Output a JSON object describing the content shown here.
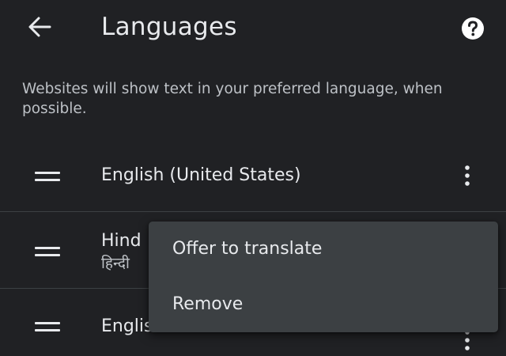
{
  "header": {
    "title": "Languages",
    "back_icon": "arrow-left-icon",
    "help_icon": "help-circle-icon"
  },
  "description": "Websites will show text in your preferred language, when possible.",
  "languages": [
    {
      "name": "English (United States)",
      "native": ""
    },
    {
      "name": "Hind",
      "native": "हिन्दी"
    },
    {
      "name": "Englis",
      "native": ""
    }
  ],
  "context_menu": {
    "items": [
      {
        "label": "Offer to translate"
      },
      {
        "label": "Remove"
      }
    ]
  },
  "colors": {
    "background": "#202124",
    "menu_background": "#3c4043",
    "text_primary": "#e8eaed",
    "text_secondary": "#bdc1c6",
    "divider": "#3c4043"
  }
}
